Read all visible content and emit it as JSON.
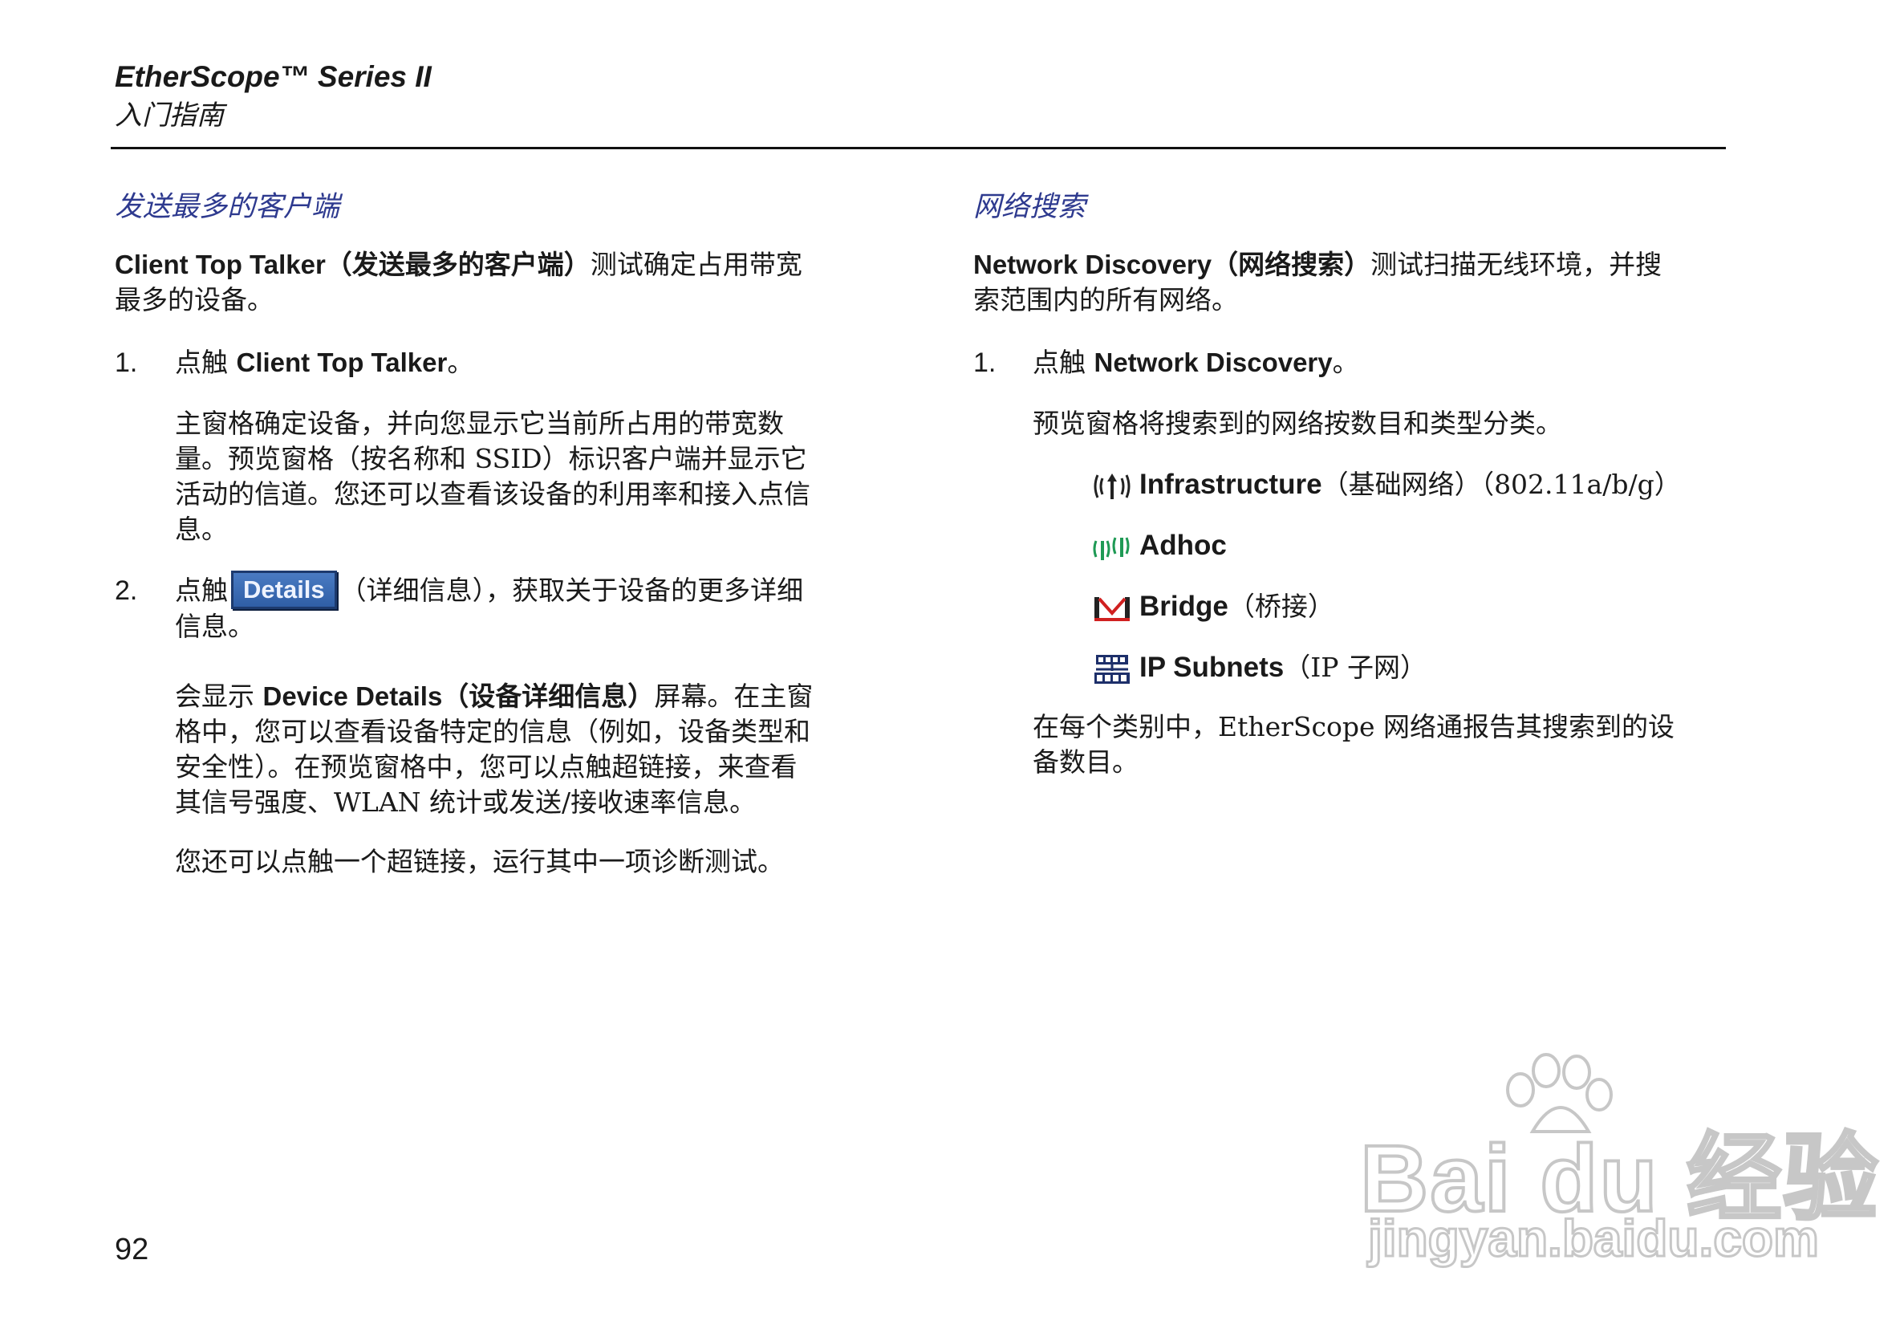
{
  "header": {
    "title": "EtherScope™ Series II",
    "subtitle": "入门指南"
  },
  "left": {
    "heading": "发送最多的客户端",
    "intro_bold": "Client Top Talker（发送最多的客户端）",
    "intro_rest_line1": "测试确定占用带宽",
    "intro_line2": "最多的设备。",
    "step1": {
      "number": "1.",
      "prefix": "点触 ",
      "bold": "Client Top Talker",
      "suffix": "。",
      "para_line1": "主窗格确定设备，并向您显示它当前所占用的带宽数",
      "para_line2": "量。预览窗格（按名称和 SSID）标识客户端并显示它",
      "para_line3": "活动的信道。您还可以查看该设备的利用率和接入点信",
      "para_line4": "息。"
    },
    "step2": {
      "number": "2.",
      "prefix": "点触",
      "button_label": "Details",
      "suffix_line1": "（详细信息），获取关于设备的更多详细",
      "line2": "信息。",
      "p2_prefix": "会显示 ",
      "p2_bold": "Device Details（设备详细信息）",
      "p2_line1_rest": "屏幕。在主窗",
      "p2_line2": "格中，您可以查看设备特定的信息（例如，设备类型和",
      "p2_line3": "安全性）。在预览窗格中，您可以点触超链接，来查看",
      "p2_line4": "其信号强度、WLAN 统计或发送/接收速率信息。",
      "p3": "您还可以点触一个超链接，运行其中一项诊断测试。"
    }
  },
  "right": {
    "heading": "网络搜索",
    "intro_bold": "Network Discovery（网络搜索）",
    "intro_rest_line1": "测试扫描无线环境，并搜",
    "intro_line2": "索范围内的所有网络。",
    "step1": {
      "number": "1.",
      "prefix": "点触 ",
      "bold": "Network Discovery",
      "suffix": "。",
      "para": "预览窗格将搜索到的网络按数目和类型分类。"
    },
    "items": [
      {
        "icon": "infrastructure-icon",
        "bold": "Infrastructure",
        "rest": "（基础网络）（802.11a/b/g）"
      },
      {
        "icon": "adhoc-icon",
        "bold": "Adhoc",
        "rest": ""
      },
      {
        "icon": "bridge-icon",
        "bold": "Bridge",
        "rest": "（桥接）"
      },
      {
        "icon": "ip-subnets-icon",
        "bold": "IP Subnets",
        "rest": "（IP 子网）"
      }
    ],
    "closing_line1": "在每个类别中，EtherScope 网络通报告其搜索到的设",
    "closing_line2": "备数目。"
  },
  "page_number": "92",
  "watermark": {
    "brand": "Bai du 经验",
    "url": "jingyan.baidu.com"
  },
  "colors": {
    "heading_blue": "#2e3a8f",
    "button_blue": "#3a6bb5",
    "adhoc_green": "#1f9a55",
    "bridge_red": "#d02020"
  }
}
